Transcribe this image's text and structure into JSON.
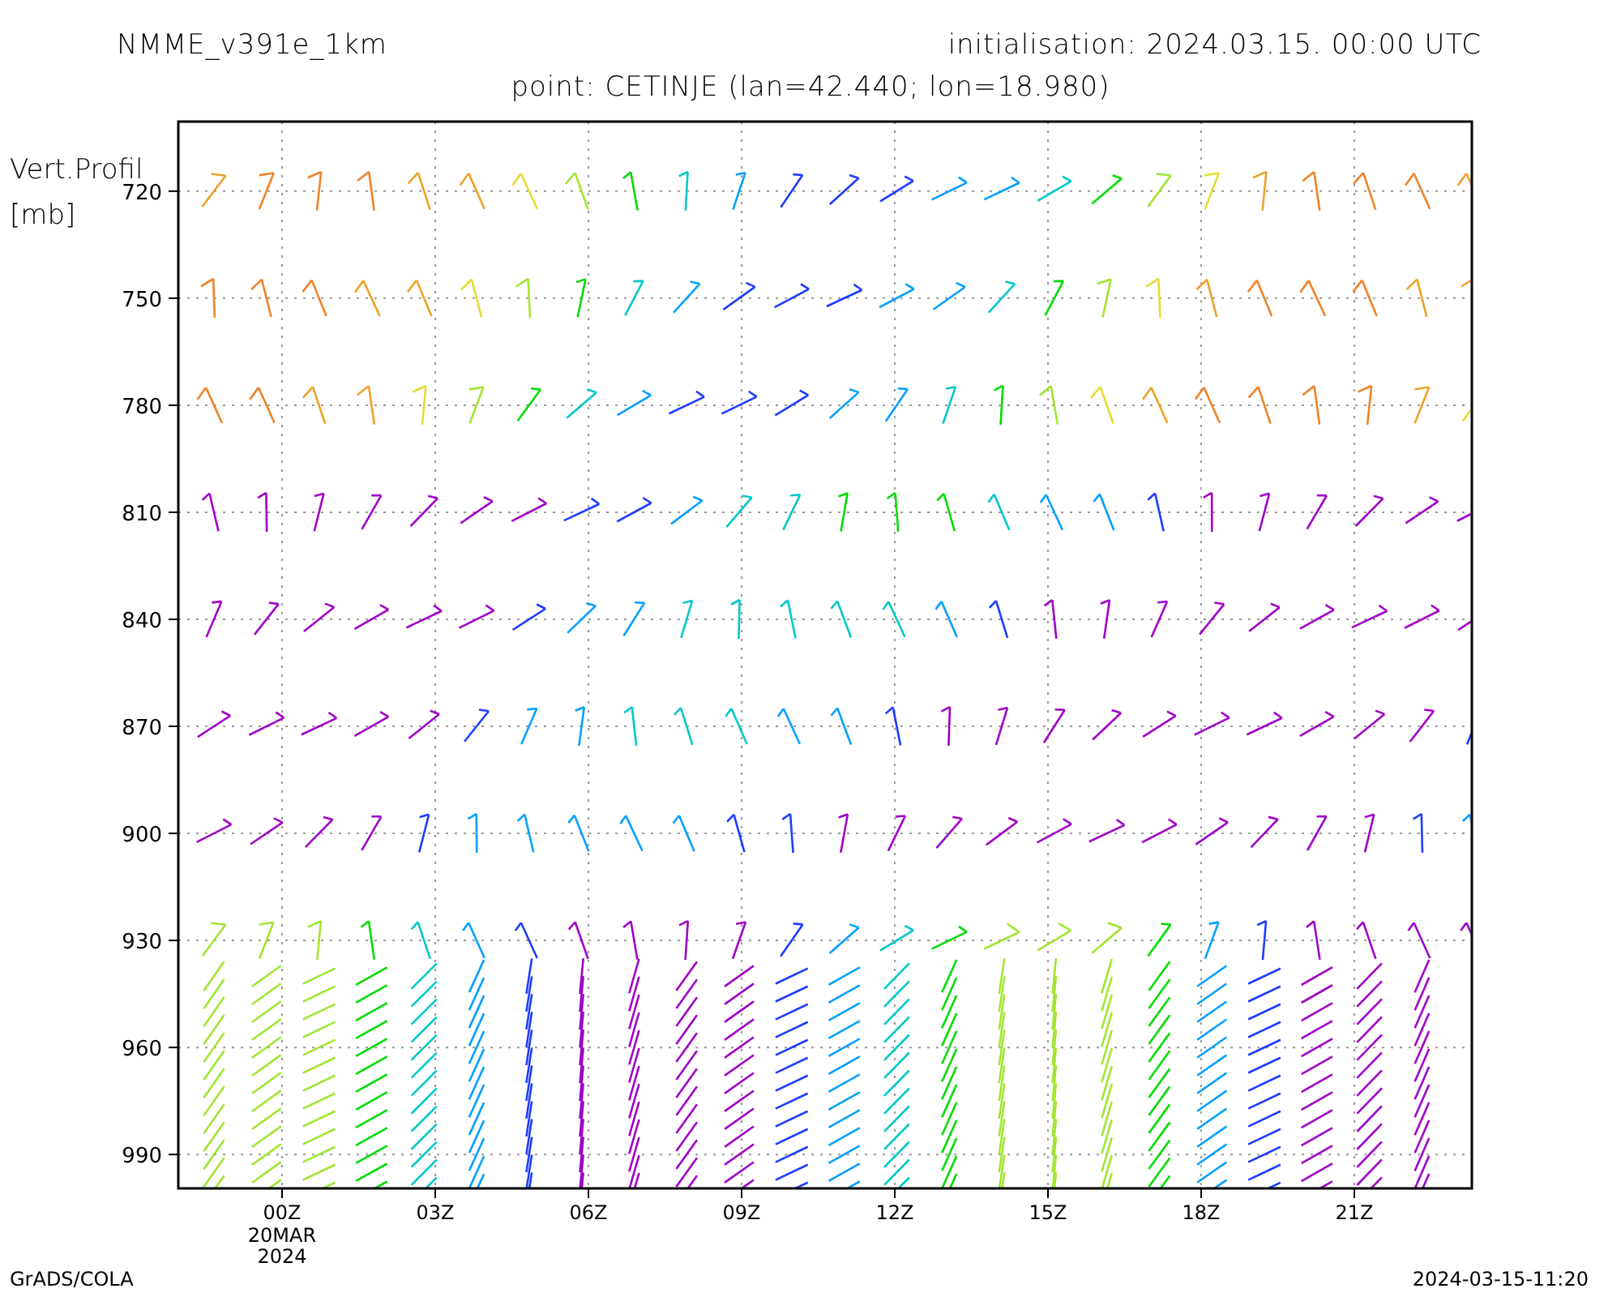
{
  "header": {
    "model": "NMME_v391e_1km",
    "initialisation": "initialisation: 2024.03.15. 00:00 UTC"
  },
  "subtitle": "point: CETINJE (lan=42.440; lon=18.980)",
  "plot": {
    "ylabel": [
      "Vert.Profil",
      "[mb]"
    ],
    "y_ticks": [
      "720",
      "750",
      "780",
      "810",
      "840",
      "870",
      "900",
      "930",
      "960",
      "990"
    ],
    "x_ticks": [
      {
        "label": "00Z",
        "date": [
          "20MAR",
          "2024"
        ]
      },
      {
        "label": "03Z"
      },
      {
        "label": "06Z"
      },
      {
        "label": "09Z"
      },
      {
        "label": "12Z"
      },
      {
        "label": "15Z"
      },
      {
        "label": "18Z"
      },
      {
        "label": "21Z"
      }
    ]
  },
  "footer": {
    "left": "GrADS/COLA",
    "right": "2024-03-15-11:20"
  }
}
